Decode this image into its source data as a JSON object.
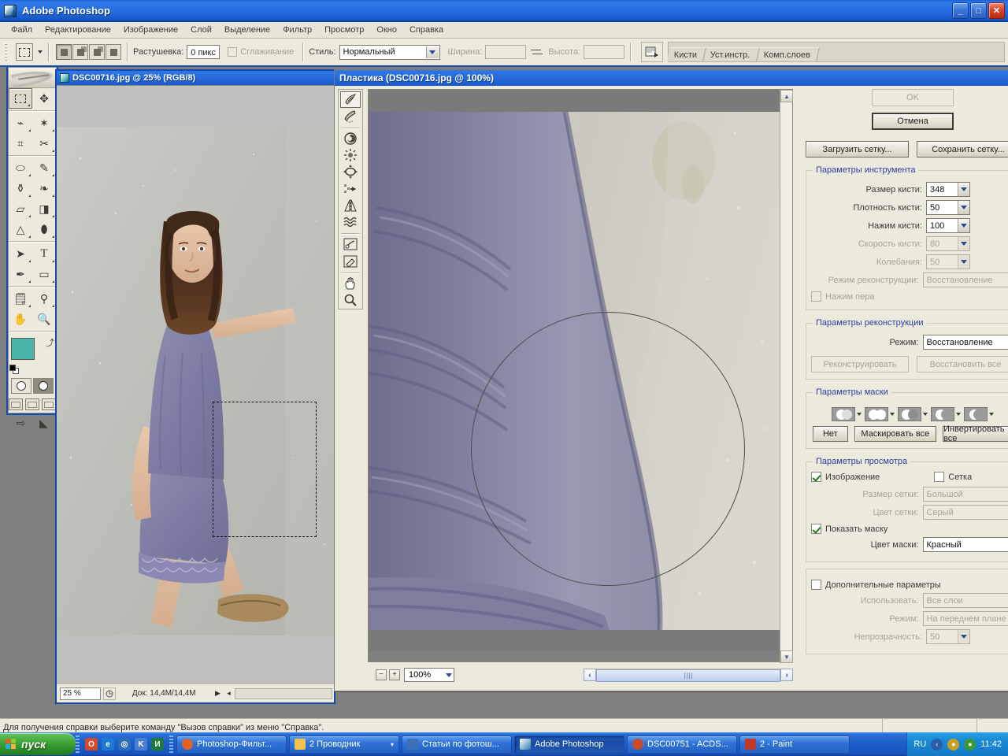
{
  "app": {
    "title": "Adobe Photoshop",
    "icon": "photoshop-logo-icon",
    "window_controls": {
      "minimize": "_",
      "maximize": "□",
      "close": "✕"
    }
  },
  "menu": {
    "items": [
      "Файл",
      "Редактирование",
      "Изображение",
      "Слой",
      "Выделение",
      "Фильтр",
      "Просмотр",
      "Окно",
      "Справка"
    ]
  },
  "options_bar": {
    "feather_label": "Растушевка:",
    "feather_value": "0 пикс",
    "antialias_label": "Сглаживание",
    "style_label": "Стиль:",
    "style_value": "Нормальный",
    "width_label": "Ширина:",
    "width_value": "",
    "height_label": "Высота:",
    "height_value": "",
    "palette_tabs": [
      "Кисти",
      "Уст.инстр.",
      "Комп.слоев"
    ]
  },
  "document_window": {
    "title": "DSC00716.jpg @ 25% (RGB/8)",
    "status": {
      "zoom": "25 %",
      "doc_info": "Док: 14,4M/14,4M"
    }
  },
  "liquify": {
    "title": "Пластика (DSC00716.jpg @ 100%)",
    "tools": [
      "forward-warp-tool",
      "reconstruct-tool",
      "twirl-clockwise-tool",
      "pucker-tool",
      "bloat-tool",
      "push-left-tool",
      "mirror-tool",
      "turbulence-tool",
      "freeze-mask-tool",
      "thaw-mask-tool",
      "hand-tool",
      "zoom-tool"
    ],
    "buttons": {
      "ok": "OK",
      "cancel": "Отмена",
      "load_mesh": "Загрузить сетку...",
      "save_mesh": "Сохранить сетку..."
    },
    "tool_options": {
      "legend": "Параметры инструмента",
      "brush_size_label": "Размер кисти:",
      "brush_size_value": "348",
      "brush_density_label": "Плотность кисти:",
      "brush_density_value": "50",
      "brush_pressure_label": "Нажим кисти:",
      "brush_pressure_value": "100",
      "brush_rate_label": "Скорость кисти:",
      "brush_rate_value": "80",
      "turbulent_jitter_label": "Колебания:",
      "turbulent_jitter_value": "50",
      "reconstruct_mode_label": "Режим реконструкции:",
      "reconstruct_mode_value": "Восстановление",
      "stylus_pressure_label": "Нажим пера"
    },
    "reconstruct_options": {
      "legend": "Параметры реконструкции",
      "mode_label": "Режим:",
      "mode_value": "Восстановление",
      "reconstruct_button": "Реконструировать",
      "restore_all_button": "Восстановить все"
    },
    "mask_options": {
      "legend": "Параметры маски",
      "icons": [
        "mask-replace-selection-icon",
        "mask-add-to-selection-icon",
        "mask-subtract-from-selection-icon",
        "mask-intersect-with-selection-icon",
        "mask-invert-selection-icon"
      ],
      "none_button": "Нет",
      "mask_all_button": "Маскировать все",
      "invert_all_button": "Инвертировать все"
    },
    "view_options": {
      "legend": "Параметры просмотра",
      "image_label": "Изображение",
      "image_checked": true,
      "mesh_label": "Сетка",
      "mesh_checked": false,
      "mesh_size_label": "Размер сетки:",
      "mesh_size_value": "Большой",
      "mesh_color_label": "Цвет сетки:",
      "mesh_color_value": "Серый",
      "show_mask_label": "Показать маску",
      "show_mask_checked": true,
      "mask_color_label": "Цвет маски:",
      "mask_color_value": "Красный",
      "backdrop_label": "Дополнительные параметры",
      "backdrop_checked": false,
      "use_label": "Использовать:",
      "use_value": "Все слои",
      "mode_label": "Режим:",
      "mode_value": "На переднем плане",
      "opacity_label": "Непрозрачность:",
      "opacity_value": "50"
    },
    "zoom": {
      "minus": "−",
      "plus": "+",
      "value": "100%"
    }
  },
  "status_bar": {
    "hint": "Для получения справки выберите команду \"Вызов справки\" из меню \"Справка\"."
  },
  "taskbar": {
    "start_label": "пуск",
    "quick_launch": [
      {
        "name": "opera-icon",
        "glyph": "O",
        "color": "#d64b2a"
      },
      {
        "name": "internet-explorer-icon",
        "glyph": "e",
        "color": "#1d7ad4"
      },
      {
        "name": "browser-icon",
        "glyph": "◎",
        "color": "#2a6fb8"
      },
      {
        "name": "k-app-icon",
        "glyph": "K",
        "color": "#4a7fd0"
      },
      {
        "name": "excel-icon",
        "glyph": "И",
        "color": "#1d7a3a"
      }
    ],
    "tasks": [
      {
        "label": "Photoshop-Фильт...",
        "icon_color": "#e06225",
        "active": false,
        "has_arrow": false
      },
      {
        "label": "2 Проводник",
        "icon_color": "#f0c14b",
        "active": false,
        "has_arrow": true
      },
      {
        "label": "Статьи по фотош...",
        "icon_color": "#3c6fb5",
        "active": false,
        "has_arrow": false
      },
      {
        "label": "Adobe Photoshop",
        "icon_color": "#2d7ca8",
        "active": true,
        "has_arrow": false
      },
      {
        "label": "DSC00751 - ACDS...",
        "icon_color": "#c84b2a",
        "active": false,
        "has_arrow": false
      },
      {
        "label": "2 - Paint",
        "icon_color": "#c0392b",
        "active": false,
        "has_arrow": false
      }
    ],
    "tray": {
      "language": "RU",
      "icons": [
        {
          "name": "network-icon",
          "glyph": "‹",
          "color": "#2a5fa8"
        },
        {
          "name": "notification-icon",
          "glyph": "●",
          "color": "#c8a020"
        },
        {
          "name": "antivirus-icon",
          "glyph": "●",
          "color": "#3a9a3a"
        }
      ],
      "clock": "11:42"
    }
  },
  "toolbox": {
    "tools": [
      "rectangular-marquee-tool",
      "move-tool",
      "lasso-tool",
      "magic-wand-tool",
      "crop-tool",
      "slice-tool",
      "healing-brush-tool",
      "brush-tool",
      "clone-stamp-tool",
      "history-brush-tool",
      "eraser-tool",
      "gradient-tool",
      "blur-tool",
      "dodge-tool",
      "path-selection-tool",
      "type-tool",
      "pen-tool",
      "shape-tool",
      "notes-tool",
      "eyedropper-tool",
      "hand-tool",
      "zoom-tool"
    ],
    "foreground_color": "#4cb5ab",
    "background_color": "#ffffff"
  }
}
